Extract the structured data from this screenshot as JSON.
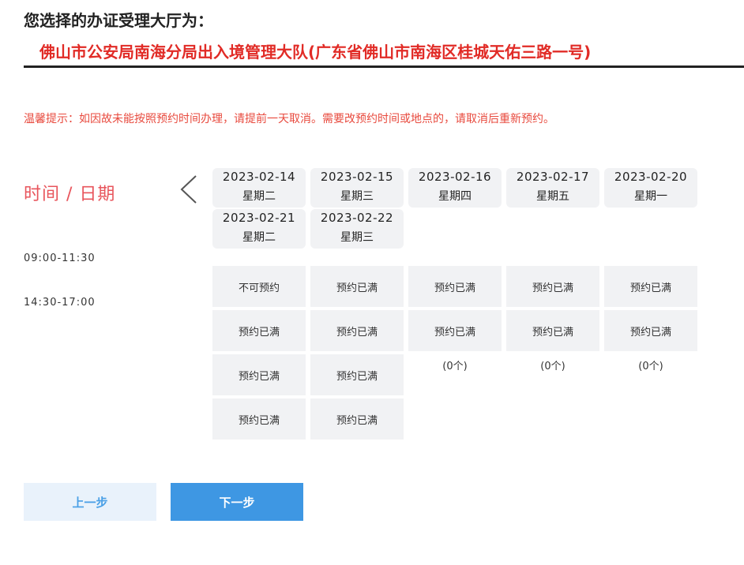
{
  "header": {
    "label": "您选择的办证受理大厅为：",
    "hall_name": "佛山市公安局南海分局出入境管理大队(广东省佛山市南海区桂城天佑三路一号)"
  },
  "tip": "温馨提示：如因故未能按照预约时间办理，请提前一天取消。需要改预约时间或地点的，请取消后重新预约。",
  "schedule": {
    "time_date_label": "时间 / 日期",
    "time_slots": [
      "09:00-11:30",
      "14:30-17:00"
    ],
    "dates": [
      {
        "date": "2023-02-14",
        "weekday": "星期二"
      },
      {
        "date": "2023-02-15",
        "weekday": "星期三"
      },
      {
        "date": "2023-02-16",
        "weekday": "星期四"
      },
      {
        "date": "2023-02-17",
        "weekday": "星期五"
      },
      {
        "date": "2023-02-20",
        "weekday": "星期一"
      },
      {
        "date": "2023-02-21",
        "weekday": "星期二"
      },
      {
        "date": "2023-02-22",
        "weekday": "星期三"
      }
    ],
    "cells": [
      "不可预约",
      "预约已满",
      "预约已满",
      "预约已满",
      "预约已满",
      "预约已满",
      "预约已满",
      "预约已满",
      "预约已满",
      "预约已满",
      "预约已满",
      "预约已满",
      "预约已满",
      "预约已满"
    ],
    "counts": [
      "(0个)",
      "(0个)",
      "(0个)"
    ]
  },
  "buttons": {
    "prev": "上一步",
    "next": "下一步"
  },
  "colors": {
    "accent_red": "#e12b26",
    "primary_blue": "#3e97e3",
    "cell_bg": "#f1f2f4"
  }
}
